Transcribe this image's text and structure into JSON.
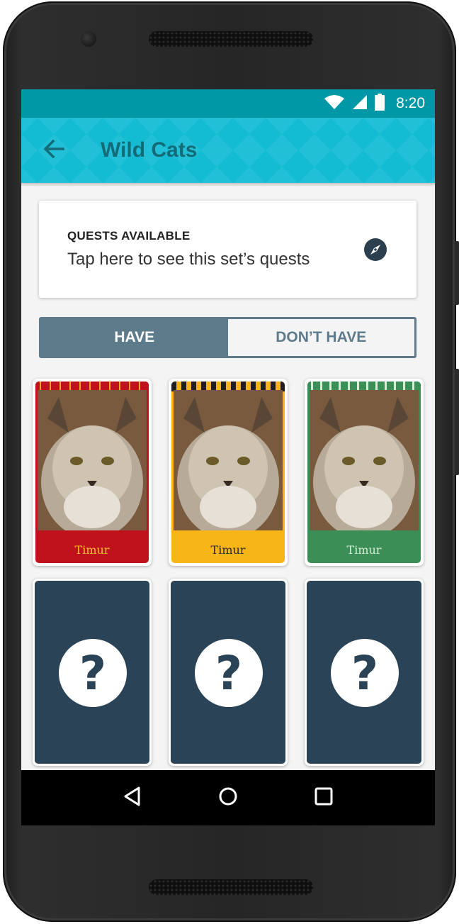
{
  "status_bar": {
    "time": "8:20"
  },
  "app_bar": {
    "title": "Wild Cats"
  },
  "quests": {
    "heading": "QUESTS AVAILABLE",
    "subtitle": "Tap here to see this set’s quests"
  },
  "tabs": {
    "have": "HAVE",
    "dont_have": "DON’T HAVE",
    "selected": "have"
  },
  "cards": [
    {
      "name": "Timur",
      "color": "#c0121c",
      "name_color": "#f5c12e"
    },
    {
      "name": "Timur",
      "color": "#f7b517",
      "name_color": "#2a2a2a"
    },
    {
      "name": "Timur",
      "color": "#3b8e55",
      "name_color": "#d6ecd6"
    }
  ],
  "unknown_cards": [
    {
      "symbol": "?"
    },
    {
      "symbol": "?"
    },
    {
      "symbol": "?"
    }
  ],
  "colors": {
    "status_bar": "#0097a7",
    "app_bar": "#14bcd3",
    "toggle_active": "#5e7b8c",
    "unknown_card": "#2b4356"
  }
}
